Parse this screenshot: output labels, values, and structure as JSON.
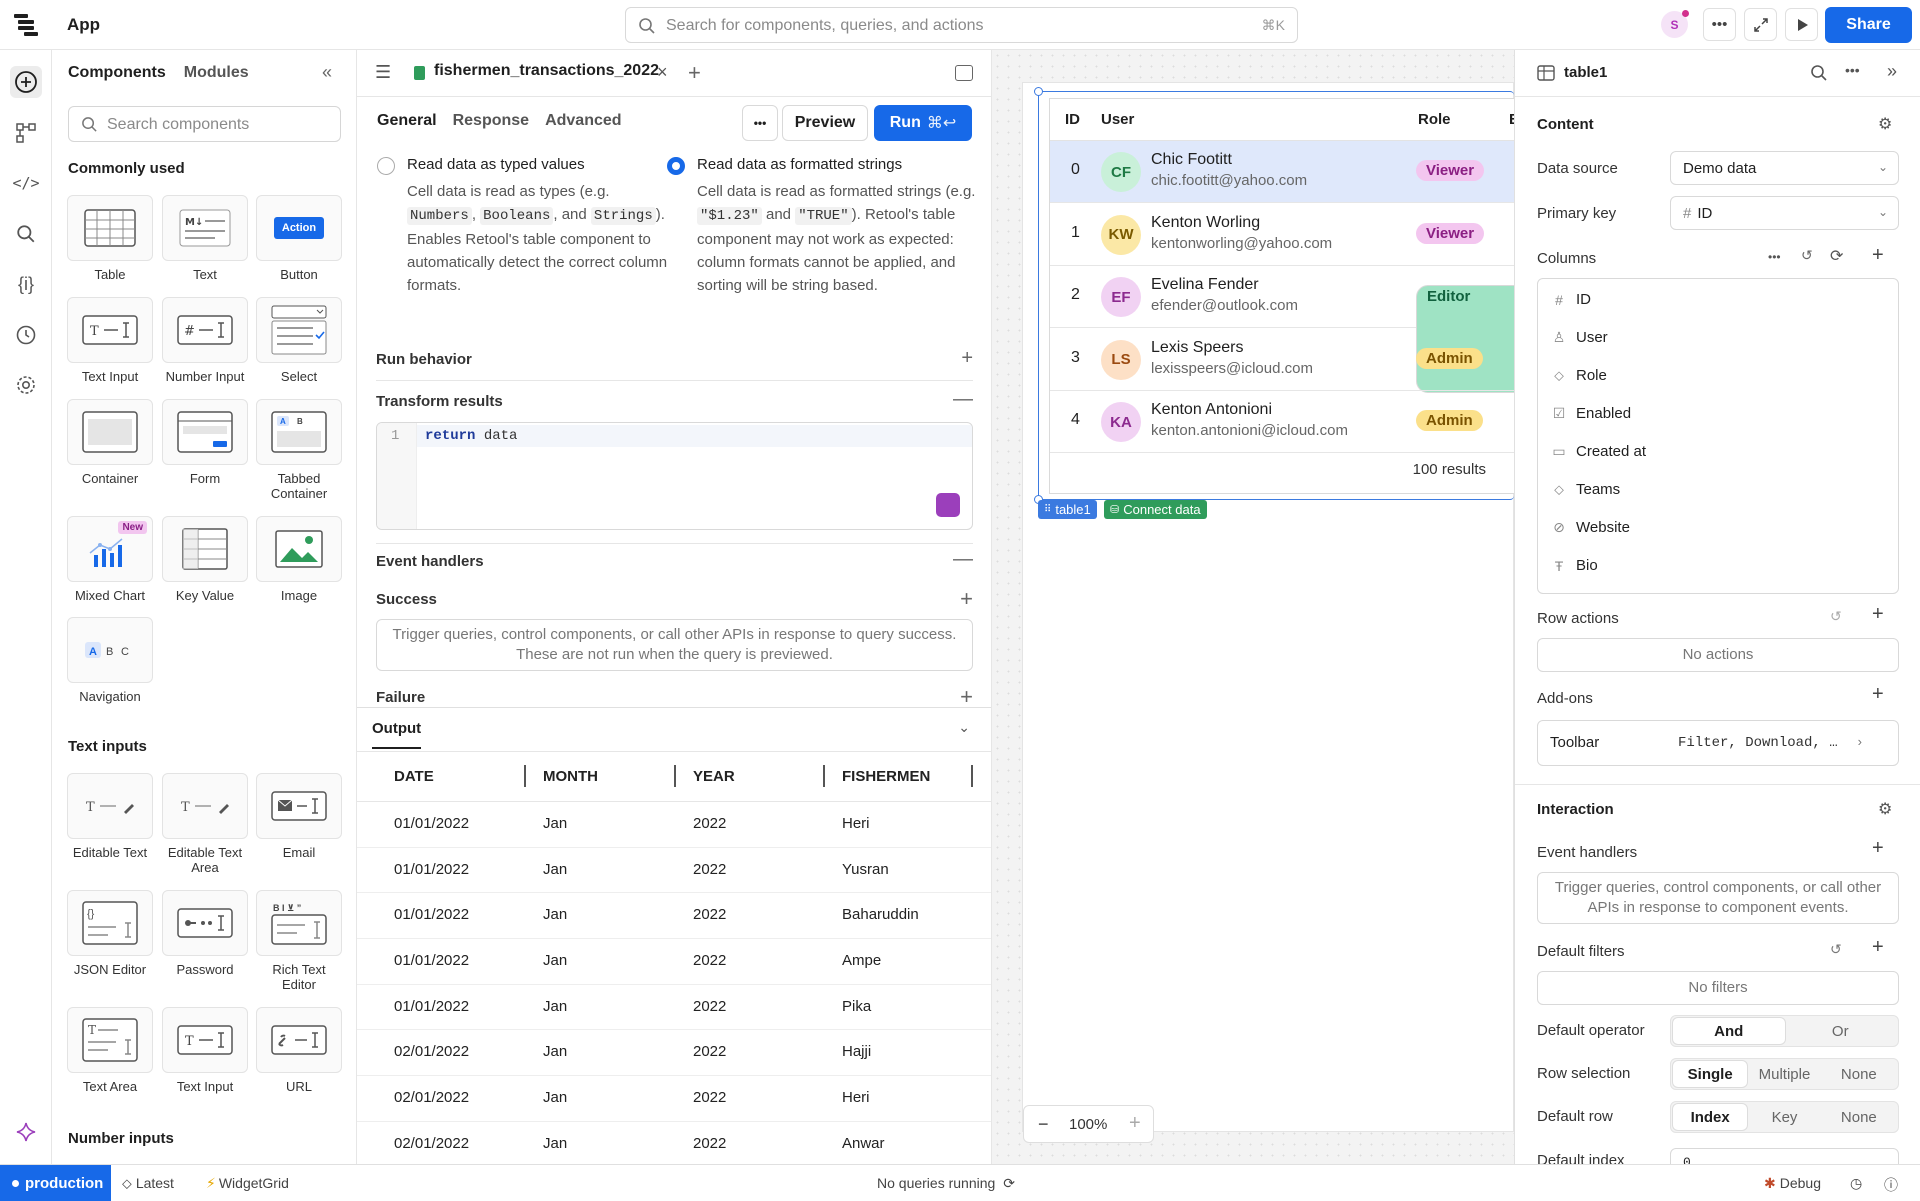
{
  "topbar": {
    "app_title": "App",
    "search_placeholder": "Search for components, queries, and actions",
    "search_shortcut": "⌘K",
    "avatar_initial": "S",
    "share_label": "Share"
  },
  "components_panel": {
    "tab_components": "Components",
    "tab_modules": "Modules",
    "search_placeholder": "Search components",
    "commonly_used_heading": "Commonly used",
    "commonly_used": [
      "Table",
      "Text",
      "Button",
      "Text Input",
      "Number Input",
      "Select",
      "Container",
      "Form",
      "Tabbed Container",
      "Mixed Chart",
      "Key Value",
      "Image",
      "Navigation"
    ],
    "button_preview": "Action",
    "new_badge": "New",
    "text_inputs_heading": "Text inputs",
    "text_inputs": [
      "Editable Text",
      "Editable Text Area",
      "Email",
      "JSON Editor",
      "Password",
      "Rich Text Editor",
      "Text Area",
      "Text Input",
      "URL"
    ],
    "number_inputs_heading": "Number inputs"
  },
  "query": {
    "tab_name": "fishermen_transactions_2022",
    "subtabs": [
      "General",
      "Response",
      "Advanced"
    ],
    "preview_label": "Preview",
    "run_label": "Run",
    "run_shortcut": "⌘↩",
    "option_typed_title": "Read data as typed values",
    "option_typed_desc_1": "Cell data is read as types (e.g.",
    "option_typed_code_1": "Numbers",
    "option_typed_code_2": "Booleans",
    "option_typed_desc_2": ", and",
    "option_typed_code_3": "Strings",
    "option_typed_desc_3": "). Enables Retool's table component to automatically detect the correct column formats.",
    "option_formatted_title": "Read data as formatted strings",
    "option_formatted_desc_1": "Cell data is read as formatted strings (e.g.",
    "option_formatted_code_1": "\"$1.23\"",
    "option_formatted_desc_2": "and",
    "option_formatted_code_2": "\"TRUE\"",
    "option_formatted_desc_3": "). Retool's table component may not work as expected: column formats cannot be applied, and sorting will be string based.",
    "run_behavior": "Run behavior",
    "transform_results": "Transform results",
    "code_line_number": "1",
    "code_keyword": "return",
    "code_value": "data",
    "event_handlers": "Event handlers",
    "success": "Success",
    "success_empty": "Trigger queries, control components, or call other APIs in response to query success. These are not run when the query is previewed.",
    "failure": "Failure",
    "output_label": "Output",
    "output_columns": [
      "DATE",
      "MONTH",
      "YEAR",
      "FISHERMEN"
    ],
    "output_rows": [
      [
        "01/01/2022",
        "Jan",
        "2022",
        "Heri"
      ],
      [
        "01/01/2022",
        "Jan",
        "2022",
        "Yusran"
      ],
      [
        "01/01/2022",
        "Jan",
        "2022",
        "Baharuddin"
      ],
      [
        "01/01/2022",
        "Jan",
        "2022",
        "Ampe"
      ],
      [
        "01/01/2022",
        "Jan",
        "2022",
        "Pika"
      ],
      [
        "02/01/2022",
        "Jan",
        "2022",
        "Hajji"
      ],
      [
        "02/01/2022",
        "Jan",
        "2022",
        "Heri"
      ],
      [
        "02/01/2022",
        "Jan",
        "2022",
        "Anwar"
      ]
    ]
  },
  "canvas": {
    "table_columns": [
      "ID",
      "User",
      "Role",
      "E"
    ],
    "users": [
      {
        "id": "0",
        "initials": "CF",
        "name": "Chic Footitt",
        "email": "chic.footitt@yahoo.com",
        "role": "Viewer",
        "avatar_bg": "#c9f0d9",
        "avatar_fg": "#1f7a45"
      },
      {
        "id": "1",
        "initials": "KW",
        "name": "Kenton Worling",
        "email": "kentonworling@yahoo.com",
        "role": "Viewer",
        "avatar_bg": "#fbe8a6",
        "avatar_fg": "#7a5a00"
      },
      {
        "id": "2",
        "initials": "EF",
        "name": "Evelina Fender",
        "email": "efender@outlook.com",
        "role": "Editor",
        "avatar_bg": "#f1d2f3",
        "avatar_fg": "#8c2a8f"
      },
      {
        "id": "3",
        "initials": "LS",
        "name": "Lexis Speers",
        "email": "lexisspeers@icloud.com",
        "role": "Admin",
        "avatar_bg": "#fde0c6",
        "avatar_fg": "#9b4a10"
      },
      {
        "id": "4",
        "initials": "KA",
        "name": "Kenton Antonioni",
        "email": "kenton.antonioni@icloud.com",
        "role": "Admin",
        "avatar_bg": "#f1d2f3",
        "avatar_fg": "#8c2a8f"
      }
    ],
    "results_label": "100 results",
    "chip_table": "table1",
    "chip_connect": "Connect data",
    "zoom_level": "100%"
  },
  "inspector": {
    "component_name": "table1",
    "content_heading": "Content",
    "data_source_label": "Data source",
    "data_source_value": "Demo data",
    "primary_key_label": "Primary key",
    "primary_key_value": "ID",
    "columns_label": "Columns",
    "columns": [
      "ID",
      "User",
      "Role",
      "Enabled",
      "Created at",
      "Teams",
      "Website",
      "Bio"
    ],
    "row_actions_label": "Row actions",
    "row_actions_empty": "No actions",
    "addons_label": "Add-ons",
    "toolbar_label": "Toolbar",
    "toolbar_value": "Filter, Download, …",
    "interaction_heading": "Interaction",
    "event_handlers_label": "Event handlers",
    "event_handlers_empty": "Trigger queries, control components, or call other APIs in response to component events.",
    "default_filters_label": "Default filters",
    "default_filters_empty": "No filters",
    "default_operator_label": "Default operator",
    "default_operator_options": [
      "And",
      "Or"
    ],
    "row_selection_label": "Row selection",
    "row_selection_options": [
      "Single",
      "Multiple",
      "None"
    ],
    "default_row_label": "Default row",
    "default_row_options": [
      "Index",
      "Key",
      "None"
    ],
    "default_index_label": "Default index",
    "default_index_value": "0"
  },
  "statusbar": {
    "environment": "production",
    "latest": "Latest",
    "widget": "WidgetGrid",
    "queries": "No queries running",
    "debug": "Debug"
  },
  "colors": {
    "accent": "#1769e8",
    "selected_row": "#dfe8fb"
  }
}
